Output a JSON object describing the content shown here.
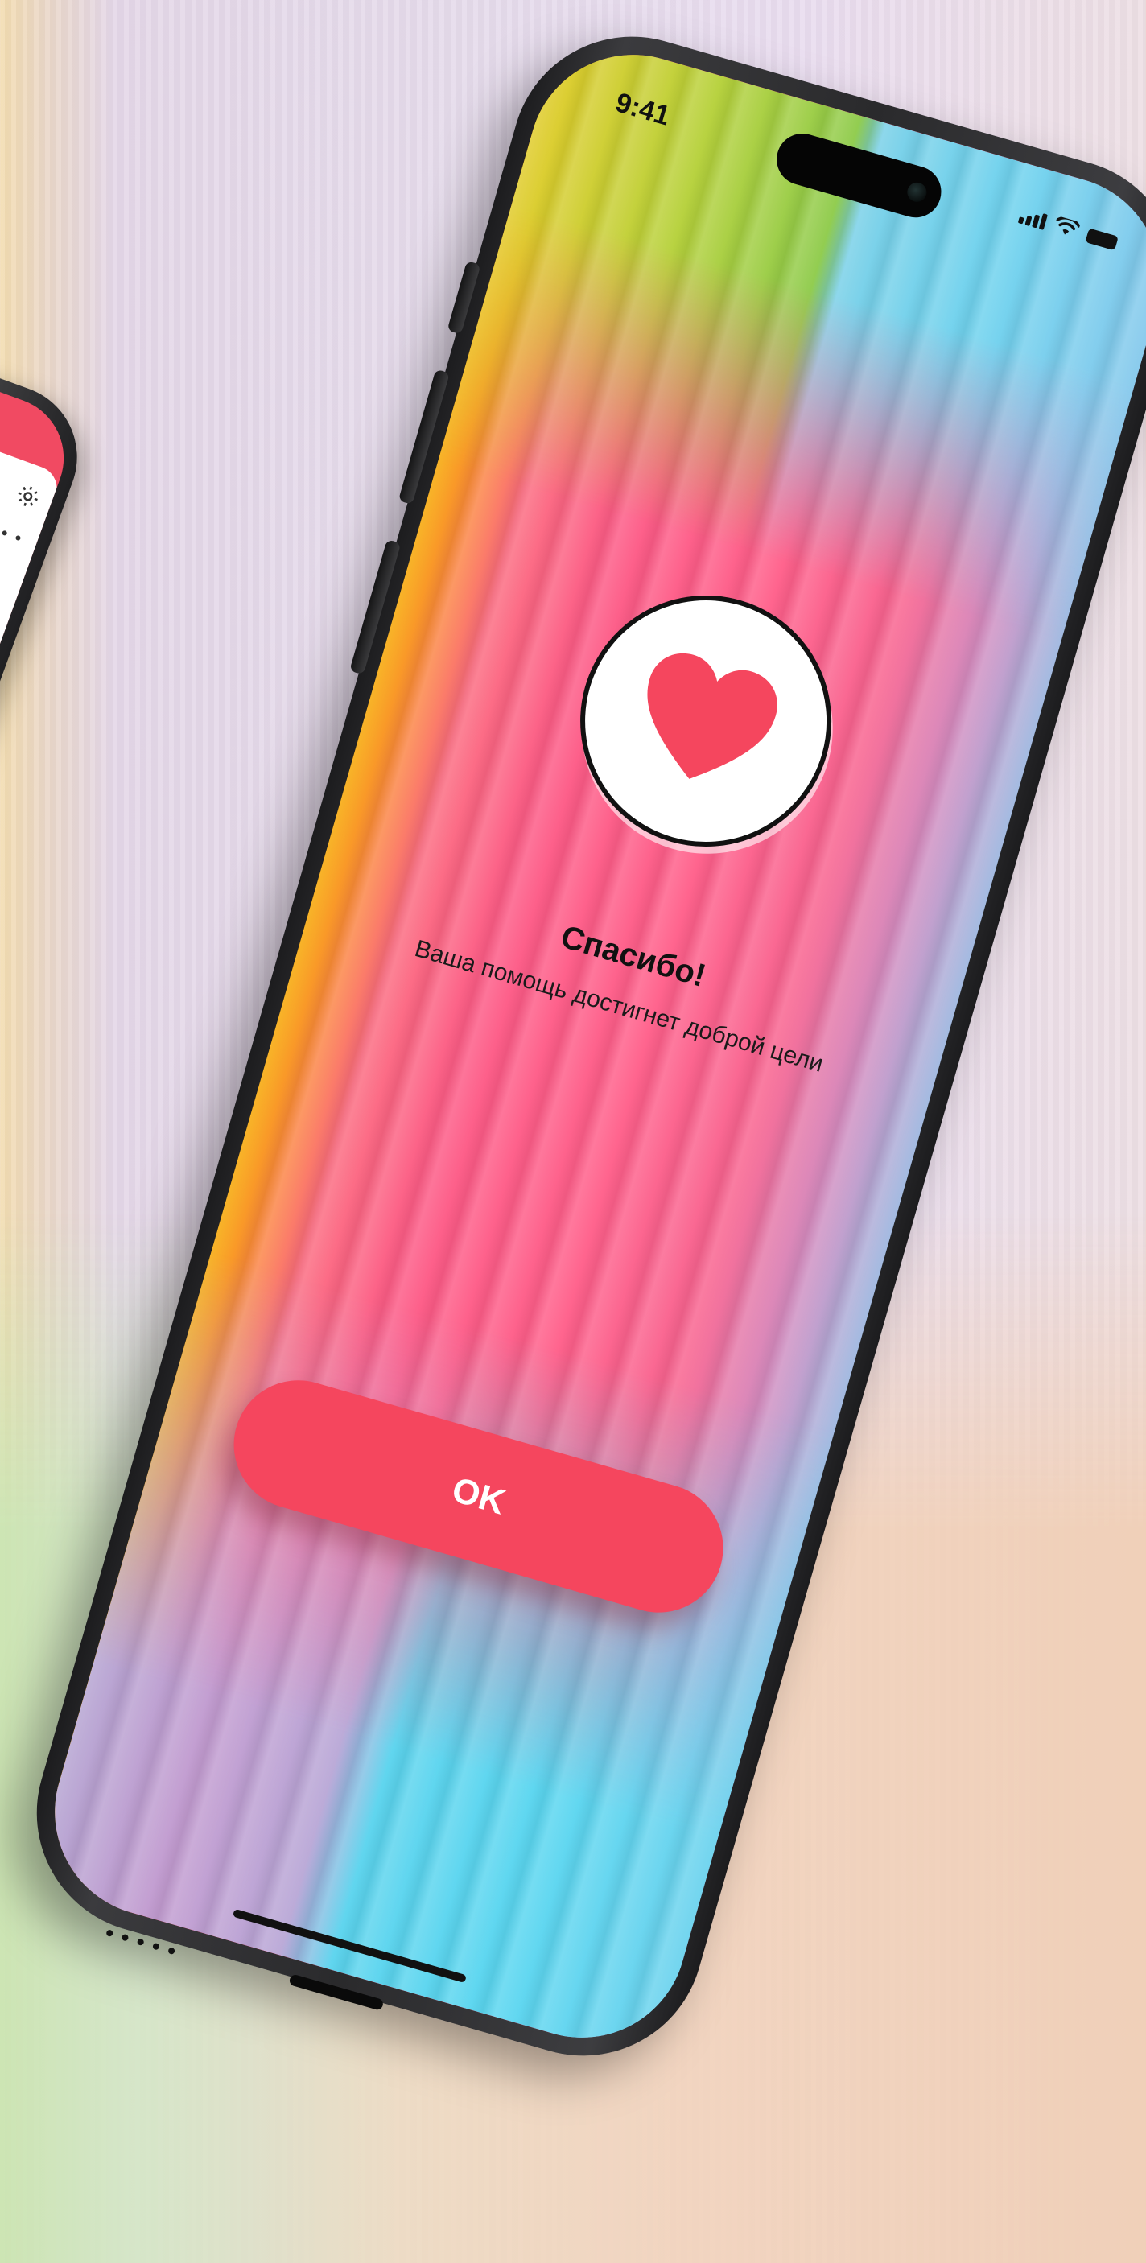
{
  "status_bar": {
    "time": "9:41",
    "icons": [
      "cellular-signal-icon",
      "wifi-icon",
      "battery-icon"
    ]
  },
  "thank_you": {
    "icon": "heart-icon",
    "title": "Спасибо!",
    "message": "Ваша помощь достигнет доброй цели",
    "button_label": "OK"
  },
  "colors": {
    "accent": "#f5465e",
    "heart": "#f5465e",
    "text": "#111111"
  },
  "background_phone": {
    "icons": [
      "gear-icon"
    ]
  }
}
